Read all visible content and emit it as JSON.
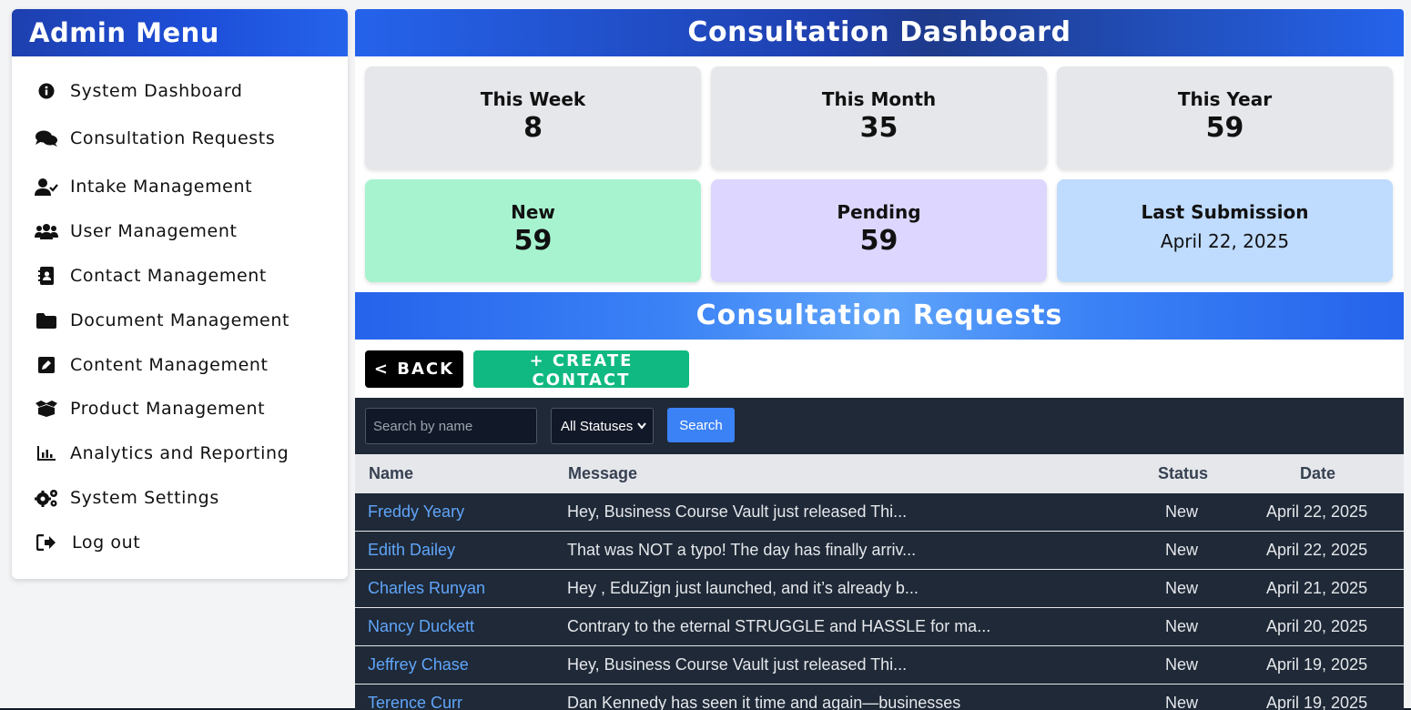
{
  "sidebar": {
    "title": "Admin Menu",
    "items": [
      {
        "label": "System Dashboard",
        "icon": "info-circle-icon"
      },
      {
        "label": "Consultation Requests",
        "icon": "comments-icon"
      },
      {
        "label": "Intake Management",
        "icon": "user-check-icon"
      },
      {
        "label": "User Management",
        "icon": "users-icon"
      },
      {
        "label": "Contact Management",
        "icon": "address-book-icon"
      },
      {
        "label": "Document Management",
        "icon": "folder-icon"
      },
      {
        "label": "Content Management",
        "icon": "edit-icon"
      },
      {
        "label": "Product Management",
        "icon": "box-open-icon"
      },
      {
        "label": "Analytics and Reporting",
        "icon": "chart-bar-icon"
      },
      {
        "label": "System Settings",
        "icon": "cogs-icon"
      },
      {
        "label": "Log out",
        "icon": "sign-out-icon"
      }
    ]
  },
  "dashboard": {
    "title": "Consultation Dashboard",
    "stats": {
      "week": {
        "label": "This Week",
        "value": "8"
      },
      "month": {
        "label": "This Month",
        "value": "35"
      },
      "year": {
        "label": "This Year",
        "value": "59"
      },
      "new": {
        "label": "New",
        "value": "59"
      },
      "pending": {
        "label": "Pending",
        "value": "59"
      },
      "last": {
        "label": "Last Submission",
        "value": "April 22, 2025"
      }
    },
    "colors": {
      "card_gray": "#e5e7eb",
      "card_new": "#a7f3d0",
      "card_pending": "#ddd6fe",
      "card_last": "#bfdbfe"
    }
  },
  "requests": {
    "title": "Consultation Requests",
    "back_label": "< BACK",
    "create_label": "+ CREATE CONTACT",
    "search_placeholder": "Search by name",
    "status_selected": "All Statuses",
    "search_button": "Search",
    "columns": {
      "name": "Name",
      "message": "Message",
      "status": "Status",
      "date": "Date"
    },
    "rows": [
      {
        "name": "Freddy Yeary",
        "message": "Hey, Business Course Vault just released Thi...",
        "status": "New",
        "date": "April 22, 2025"
      },
      {
        "name": "Edith Dailey",
        "message": "That was NOT a typo! The day has finally arriv...",
        "status": "New",
        "date": "April 22, 2025"
      },
      {
        "name": "Charles Runyan",
        "message": "Hey , EduZign just launched, and it’s already b...",
        "status": "New",
        "date": "April 21, 2025"
      },
      {
        "name": "Nancy Duckett",
        "message": "Contrary to the eternal STRUGGLE and HASSLE for ma...",
        "status": "New",
        "date": "April 20, 2025"
      },
      {
        "name": "Jeffrey Chase",
        "message": "Hey, Business Course Vault just released Thi...",
        "status": "New",
        "date": "April 19, 2025"
      },
      {
        "name": "Terence Curr",
        "message": "Dan Kennedy has seen it time and again—businesses",
        "status": "New",
        "date": "April 19, 2025"
      }
    ]
  }
}
